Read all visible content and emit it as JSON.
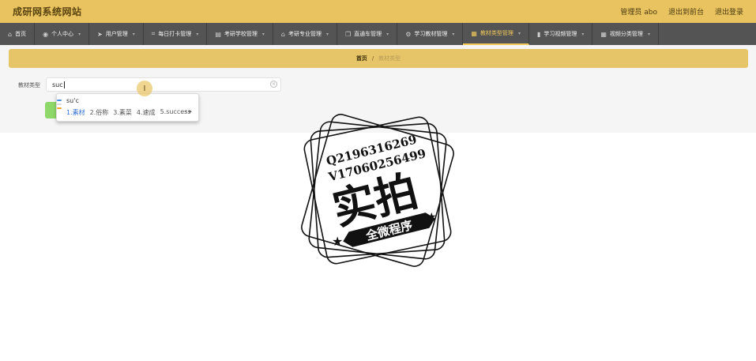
{
  "header": {
    "title": "成研网系统网站",
    "admin_label": "管理员 abo",
    "exit_front": "退出到前台",
    "logout": "退出登录"
  },
  "nav": {
    "items": [
      {
        "label": "首页",
        "icon": "home-icon",
        "glyph": "⌂"
      },
      {
        "label": "个人中心",
        "icon": "user-icon",
        "glyph": "◉"
      },
      {
        "label": "用户管理",
        "icon": "send-icon",
        "glyph": "➤"
      },
      {
        "label": "每日打卡管理",
        "icon": "crop-icon",
        "glyph": "⌗"
      },
      {
        "label": "考研学校管理",
        "icon": "file-icon",
        "glyph": "▤"
      },
      {
        "label": "考研专业管理",
        "icon": "bank-icon",
        "glyph": "⌂"
      },
      {
        "label": "直通车管理",
        "icon": "copy-icon",
        "glyph": "❐"
      },
      {
        "label": "学习教材管理",
        "icon": "settings-icon",
        "glyph": "⚙"
      },
      {
        "label": "教材类型管理",
        "icon": "database-icon",
        "glyph": "▦"
      },
      {
        "label": "学习视频管理",
        "icon": "bar-chart-icon",
        "glyph": "▮"
      },
      {
        "label": "视频分类管理",
        "icon": "grid-icon",
        "glyph": "▦"
      }
    ],
    "active_index": 8,
    "active_color": "#f0c85a"
  },
  "breadcrumb": {
    "home": "首页",
    "separator": "/",
    "current": "教材类型"
  },
  "search": {
    "label": "教材类型",
    "value": "suc"
  },
  "ime": {
    "pinyin": "su'c",
    "candidates": [
      "1.素材",
      "2.俗称",
      "3.素菜",
      "4.速成",
      "5.success"
    ],
    "selected_index": 0,
    "mark_colors": [
      "#4a90e2",
      "#dcdcdc",
      "#f5a623"
    ]
  },
  "watermark": {
    "line1": "Q2196316269",
    "line2": "V17060256499",
    "big": "实拍",
    "banner": "全微程序"
  }
}
